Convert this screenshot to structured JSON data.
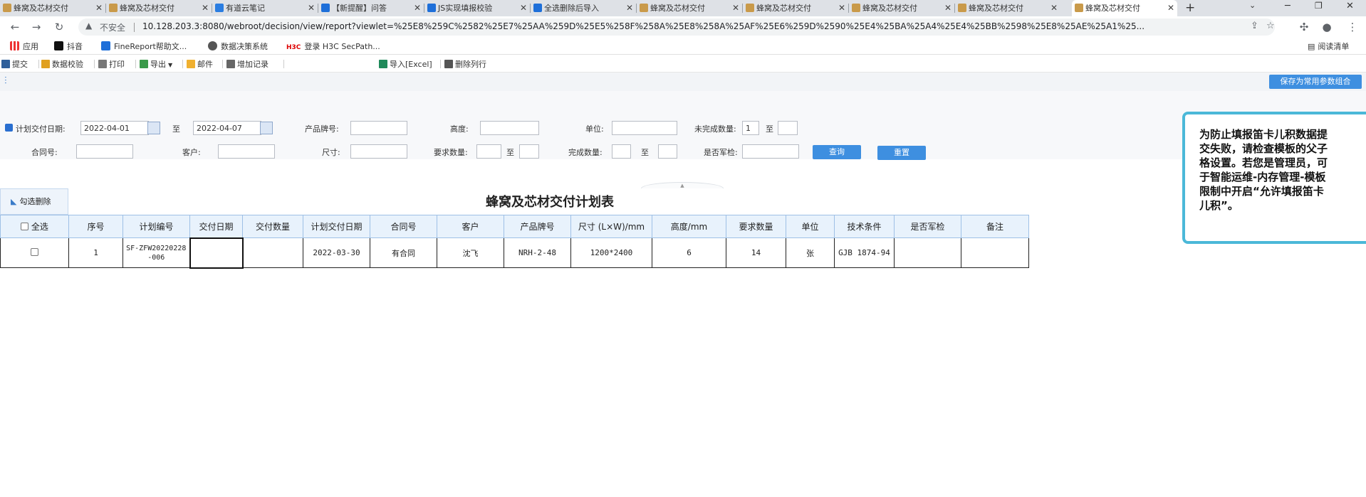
{
  "tabs": [
    {
      "label": "蜂窝及芯材交付",
      "active": false
    },
    {
      "label": "蜂窝及芯材交付",
      "active": false
    },
    {
      "label": "有道云笔记",
      "active": false
    },
    {
      "label": "【新提醒】问答",
      "active": false
    },
    {
      "label": "JS实现填报校验",
      "active": false
    },
    {
      "label": "全选删除后导入",
      "active": false
    },
    {
      "label": "蜂窝及芯材交付",
      "active": false
    },
    {
      "label": "蜂窝及芯材交付",
      "active": false
    },
    {
      "label": "蜂窝及芯材交付",
      "active": false
    },
    {
      "label": "蜂窝及芯材交付",
      "active": false
    },
    {
      "label": "蜂窝及芯材交付",
      "active": true
    }
  ],
  "address": {
    "insecure_label": "不安全",
    "url": "10.128.203.3:8080/webroot/decision/view/report?viewlet=%25E8%259C%2582%25E7%25AA%259D%25E5%258F%258A%25E8%258A%25AF%25E6%259D%2590%25E4%25BA%25A4%25E4%25BB%2598%25E8%25AE%25A1%25..."
  },
  "bookmarks": [
    "应用",
    "抖音",
    "FineReport帮助文...",
    "数据决策系统",
    "登录 H3C SecPath..."
  ],
  "reading_list": "阅读清单",
  "toolbar": {
    "submit": "提交",
    "validate": "数据校验",
    "print": "打印",
    "export": "导出",
    "mail": "邮件",
    "add_record": "增加记录",
    "import_excel": "导入[Excel]",
    "delete_row": "删除列行"
  },
  "params": {
    "save_combo": "保存为常用参数组合",
    "plan_date_label": "计划交付日期:",
    "plan_date_from": "2022-04-01",
    "to": "至",
    "plan_date_to": "2022-04-07",
    "product_label": "产品牌号:",
    "height_label": "高度:",
    "unit_label": "单位:",
    "unfinished_label": "未完成数量:",
    "unfinished_from": "1",
    "contract_label": "合同号:",
    "customer_label": "客户:",
    "size_label": "尺寸:",
    "req_qty_label": "要求数量:",
    "done_qty_label": "完成数量:",
    "military_label": "是否军检:",
    "query": "查询",
    "reset": "重置"
  },
  "notice": "为防止填报笛卡儿积数据提交失败，请检查模板的父子格设置。若您是管理员，可于智能运维-内存管理-模板限制中开启“允许填报笛卡儿积”。",
  "report": {
    "title": "蜂窝及芯材交付计划表",
    "delete_selected": "勾选删除",
    "headers": [
      "全选",
      "序号",
      "计划编号",
      "交付日期",
      "交付数量",
      "计划交付日期",
      "合同号",
      "客户",
      "产品牌号",
      "尺寸 (L×W)/mm",
      "高度/mm",
      "要求数量",
      "单位",
      "技术条件",
      "是否军检",
      "备注"
    ],
    "rows": [
      [
        "",
        "1",
        "SF-ZFW20220228-006",
        "",
        "",
        "2022-03-30",
        "有合同",
        "沈飞",
        "NRH-2-48",
        "1200*2400",
        "6",
        "14",
        "张",
        "GJB 1874-94",
        "",
        ""
      ]
    ]
  }
}
